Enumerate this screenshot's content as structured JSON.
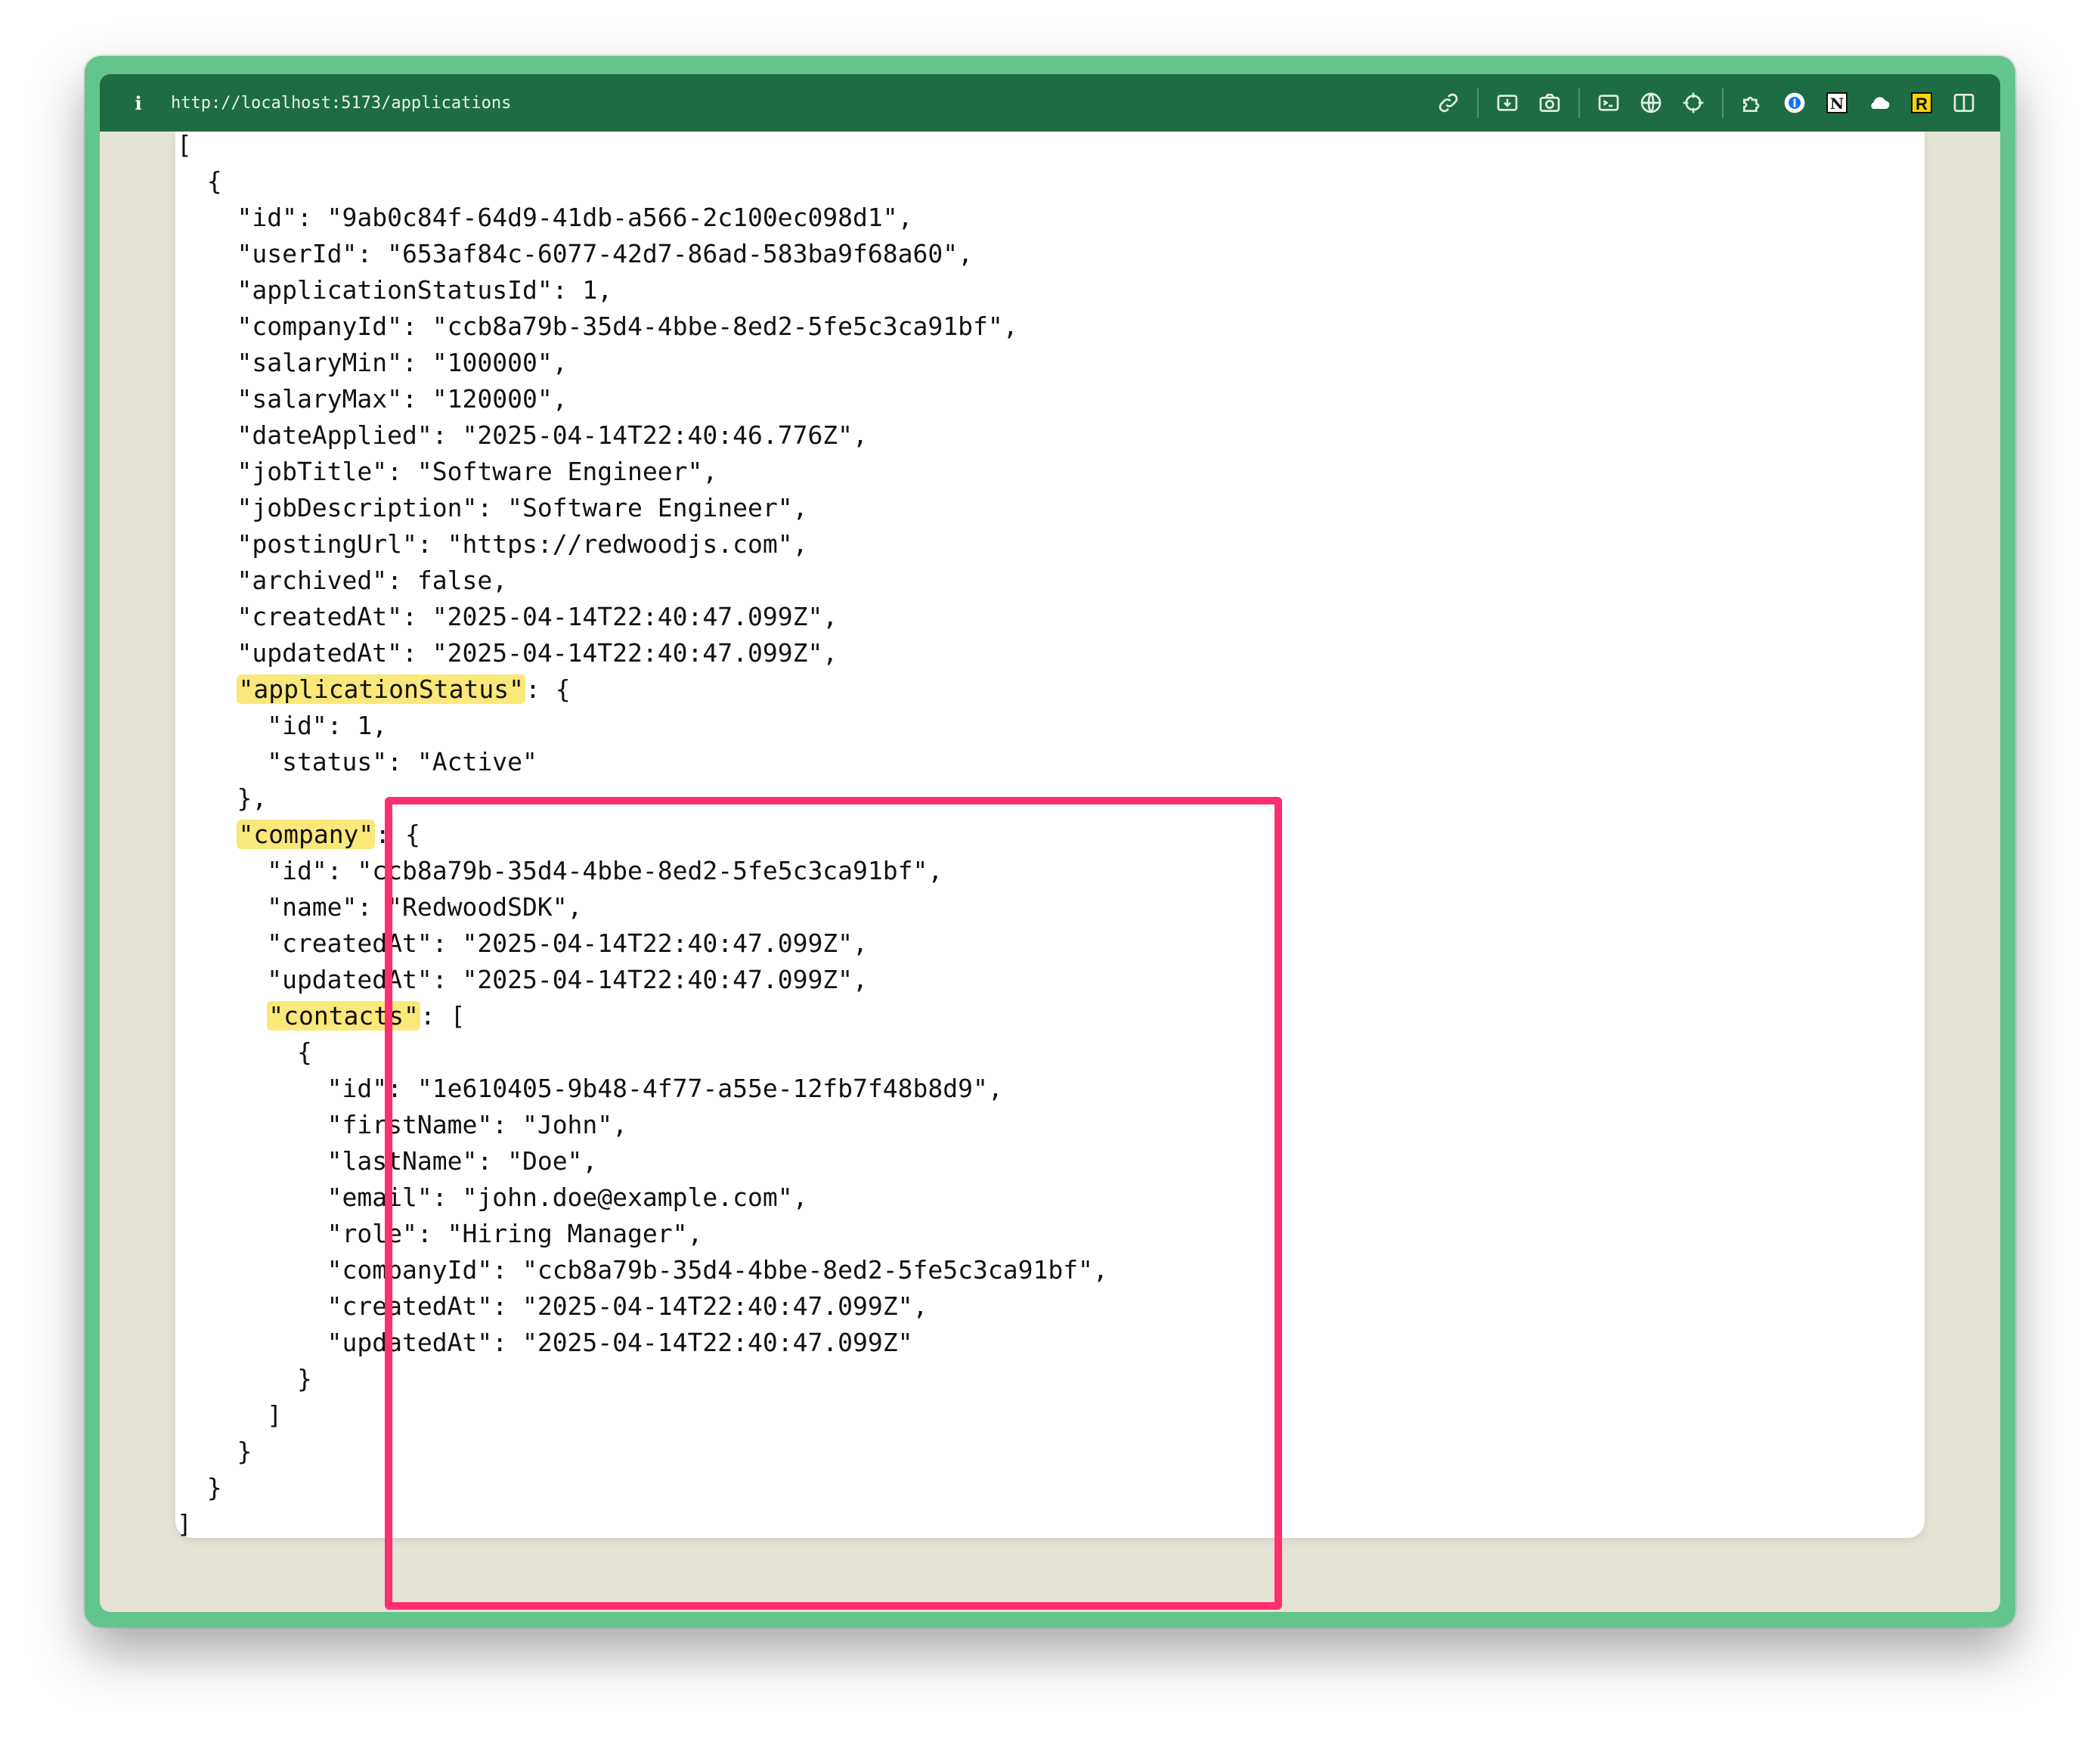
{
  "browser": {
    "url": "http://localhost:5173/applications",
    "info_icon": "info-icon",
    "toolbar_icons": [
      "link-icon",
      "download-icon",
      "camera-icon",
      "terminal-icon",
      "globe-icon",
      "crosshair-icon",
      "puzzle-icon",
      "password-icon",
      "notion-icon",
      "cloud-icon",
      "readwise-icon",
      "sidebar-icon"
    ],
    "badge_r": "R",
    "badge_n": "N",
    "accent_color": "#1e6c43",
    "frame_color": "#64c48d"
  },
  "json_lines": [
    "[",
    "  {",
    "    \"id\": \"9ab0c84f-64d9-41db-a566-2c100ec098d1\",",
    "    \"userId\": \"653af84c-6077-42d7-86ad-583ba9f68a60\",",
    "    \"applicationStatusId\": 1,",
    "    \"companyId\": \"ccb8a79b-35d4-4bbe-8ed2-5fe5c3ca91bf\",",
    "    \"salaryMin\": \"100000\",",
    "    \"salaryMax\": \"120000\",",
    "    \"dateApplied\": \"2025-04-14T22:40:46.776Z\",",
    "    \"jobTitle\": \"Software Engineer\",",
    "    \"jobDescription\": \"Software Engineer\",",
    "    \"postingUrl\": \"https://redwoodjs.com\",",
    "    \"archived\": false,",
    "    \"createdAt\": \"2025-04-14T22:40:47.099Z\",",
    "    \"updatedAt\": \"2025-04-14T22:40:47.099Z\",",
    "    \"applicationStatus\": {",
    "      \"id\": 1,",
    "      \"status\": \"Active\"",
    "    },",
    "    \"company\": {",
    "      \"id\": \"ccb8a79b-35d4-4bbe-8ed2-5fe5c3ca91bf\",",
    "      \"name\": \"RedwoodSDK\",",
    "      \"createdAt\": \"2025-04-14T22:40:47.099Z\",",
    "      \"updatedAt\": \"2025-04-14T22:40:47.099Z\",",
    "      \"contacts\": [",
    "        {",
    "          \"id\": \"1e610405-9b48-4f77-a55e-12fb7f48b8d9\",",
    "          \"firstName\": \"John\",",
    "          \"lastName\": \"Doe\",",
    "          \"email\": \"john.doe@example.com\",",
    "          \"role\": \"Hiring Manager\",",
    "          \"companyId\": \"ccb8a79b-35d4-4bbe-8ed2-5fe5c3ca91bf\",",
    "          \"createdAt\": \"2025-04-14T22:40:47.099Z\",",
    "          \"updatedAt\": \"2025-04-14T22:40:47.099Z\"",
    "        }",
    "      ]",
    "    }",
    "  }",
    "]"
  ],
  "highlighted_keys": [
    "\"applicationStatus\"",
    "\"company\"",
    "\"contacts\""
  ],
  "annotation": {
    "box_color": "#ff2e6e",
    "highlight_color": "#fbe87a"
  }
}
